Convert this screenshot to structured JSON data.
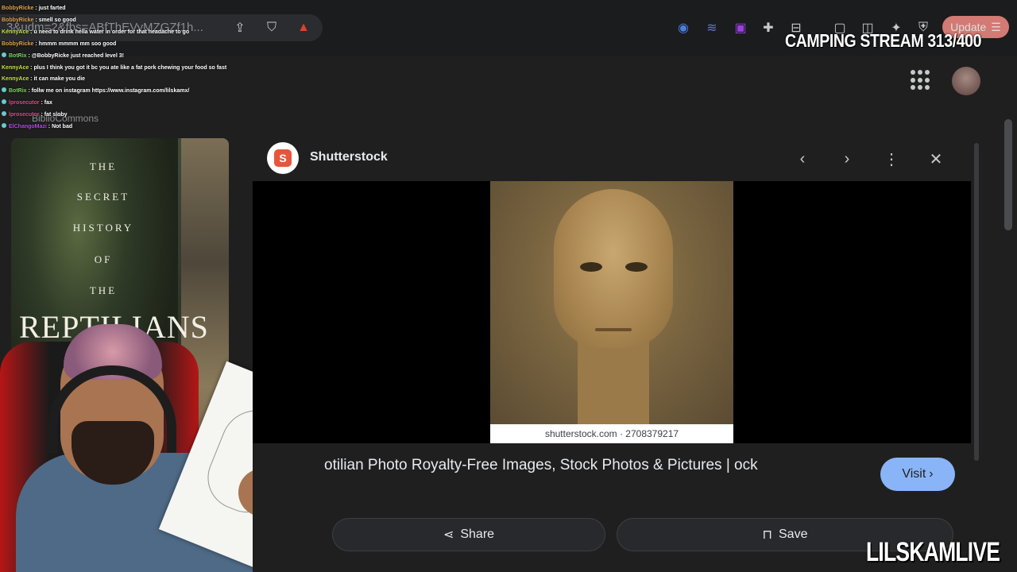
{
  "browser": {
    "url": "3&udm=2&fbs=ABfThEVyMZGZf1h...",
    "update_label": "Update"
  },
  "chat": [
    {
      "user": "BobbyRicke",
      "msg": "just farted",
      "color": "#e0a14c",
      "badge": false
    },
    {
      "user": "BobbyRicke",
      "msg": "smell so good",
      "color": "#e0a14c",
      "badge": false
    },
    {
      "user": "KennyAce",
      "msg": "u need to drink hella water in order for that headache to go",
      "color": "#c8e04c",
      "badge": false
    },
    {
      "user": "BobbyRicke",
      "msg": "hmmm mmmm mm soo good",
      "color": "#e0a14c",
      "badge": false
    },
    {
      "user": "BotRix",
      "msg": "@BobbyRicke just reached level 3!",
      "color": "#7dd65c",
      "badge": true
    },
    {
      "user": "KennyAce",
      "msg": "plus I think you got it bc you ate like a fat pork chewing your food so fast",
      "color": "#c8e04c",
      "badge": false
    },
    {
      "user": "KennyAce",
      "msg": "it can make you die",
      "color": "#c8e04c",
      "badge": false
    },
    {
      "user": "BotRix",
      "msg": "follw me on instagram https://www.instagram.com/lilskamx/",
      "color": "#7dd65c",
      "badge": true
    },
    {
      "user": "lprosecutor",
      "msg": "fax",
      "color": "#e04c8a",
      "badge": true
    },
    {
      "user": "lprosecutor",
      "msg": "fat sloby",
      "color": "#e04c8a",
      "badge": true
    },
    {
      "user": "ElChangoMazi",
      "msg": "Not bad",
      "color": "#b04ce0",
      "badge": true
    }
  ],
  "overlay": {
    "camping": "CAMPING STREAM 313/400",
    "watermark": "LILSKAMLIVE"
  },
  "left_result": {
    "source": "BiblioCommons",
    "book_lines": [
      "THE",
      "SECRET",
      "HISTORY",
      "OF",
      "THE"
    ],
    "book_big": "REPTILIANS"
  },
  "viewer": {
    "site_name": "Shutterstock",
    "site_logo_glyph": "S",
    "caption": "shutterstock.com · 2708379217",
    "title": "otilian Photo Royalty-Free Images, Stock Photos & Pictures | ock",
    "visit_label": "Visit",
    "share_label": "Share",
    "save_label": "Save"
  },
  "icons": {
    "share": "share-icon",
    "brave": "brave-shield-icon",
    "rewards": "brave-rewards-icon",
    "prev": "chevron-left-icon",
    "next": "chevron-right-icon",
    "more": "more-vert-icon",
    "close": "close-icon",
    "apps": "apps-grid-icon",
    "bookmark": "bookmark-icon"
  },
  "colors": {
    "accent_blue": "#8ab4f8",
    "shutterstock_red": "#e8553d",
    "update_red": "#f28b82"
  }
}
